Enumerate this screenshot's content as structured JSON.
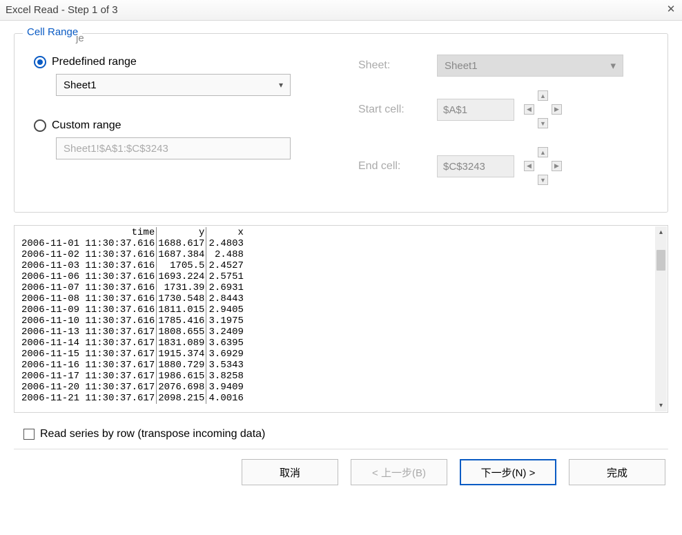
{
  "title": "Excel Read - Step 1 of 3",
  "cell_range": {
    "legend": "Cell Range",
    "shadow": "je",
    "predefined": {
      "label": "Predefined range",
      "selected": true,
      "value": "Sheet1"
    },
    "custom": {
      "label": "Custom range",
      "selected": false,
      "value": "Sheet1!$A$1:$C$3243"
    },
    "sheet": {
      "label": "Sheet:",
      "value": "Sheet1"
    },
    "start_cell": {
      "label": "Start cell:",
      "value": "$A$1"
    },
    "end_cell": {
      "label": "End cell:",
      "value": "$C$3243"
    }
  },
  "preview": {
    "headers": [
      "time",
      "y",
      "x"
    ],
    "rows": [
      [
        "2006-11-01 11:30:37.616",
        "1688.617",
        "2.4803"
      ],
      [
        "2006-11-02 11:30:37.616",
        "1687.384",
        "2.488"
      ],
      [
        "2006-11-03 11:30:37.616",
        "1705.5",
        "2.4527"
      ],
      [
        "2006-11-06 11:30:37.616",
        "1693.224",
        "2.5751"
      ],
      [
        "2006-11-07 11:30:37.616",
        "1731.39",
        "2.6931"
      ],
      [
        "2006-11-08 11:30:37.616",
        "1730.548",
        "2.8443"
      ],
      [
        "2006-11-09 11:30:37.616",
        "1811.015",
        "2.9405"
      ],
      [
        "2006-11-10 11:30:37.616",
        "1785.416",
        "3.1975"
      ],
      [
        "2006-11-13 11:30:37.617",
        "1808.655",
        "3.2409"
      ],
      [
        "2006-11-14 11:30:37.617",
        "1831.089",
        "3.6395"
      ],
      [
        "2006-11-15 11:30:37.617",
        "1915.374",
        "3.6929"
      ],
      [
        "2006-11-16 11:30:37.617",
        "1880.729",
        "3.5343"
      ],
      [
        "2006-11-17 11:30:37.617",
        "1986.615",
        "3.8258"
      ],
      [
        "2006-11-20 11:30:37.617",
        "2076.698",
        "3.9409"
      ],
      [
        "2006-11-21 11:30:37.617",
        "2098.215",
        "4.0016"
      ]
    ]
  },
  "transpose": {
    "label": "Read series by row (transpose incoming data)",
    "checked": false
  },
  "buttons": {
    "cancel": "取消",
    "back": "< 上一步(B)",
    "next": "下一步(N) >",
    "finish": "完成"
  }
}
